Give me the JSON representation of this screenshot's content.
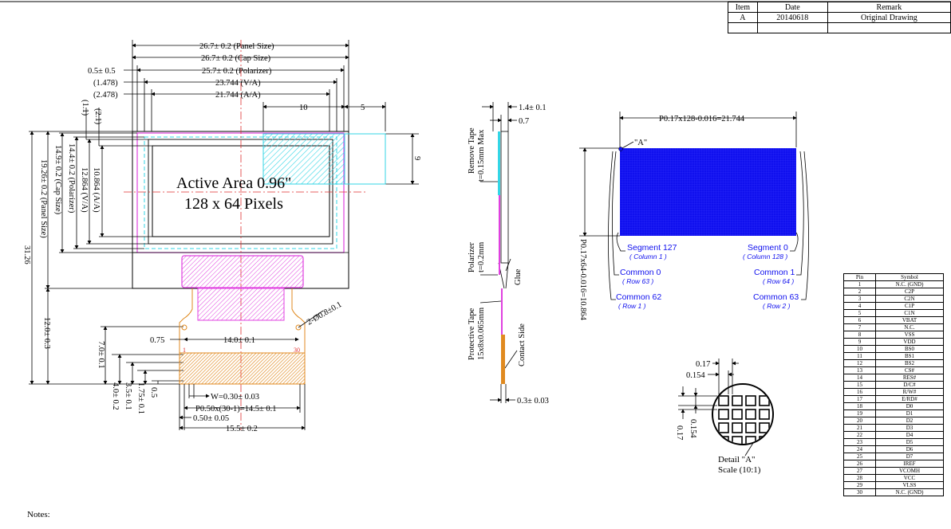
{
  "revision_table": {
    "headers": [
      "Item",
      "Date",
      "Remark"
    ],
    "rows": [
      [
        "A",
        "20140618",
        "Original Drawing"
      ],
      [
        "",
        "",
        ""
      ]
    ]
  },
  "front_view": {
    "dims_top": {
      "panel_size": "26.7± 0.2 (Panel Size)",
      "cap_size": "26.7± 0.2 (Cap Size)",
      "polarizer": "25.7± 0.2 (Polarizer)",
      "va": "23.744 (V/A)",
      "aa": "21.744 (A/A)",
      "offset_1": "0.5± 0.5",
      "offset_2": "(1.478)",
      "offset_3": "(2.478)",
      "dim_10": "10",
      "dim_5": "5",
      "dim_9": "9"
    },
    "dims_left": {
      "d1": "(1.1)",
      "d2": "(2.1)",
      "aa": "10.864 (A/A)",
      "va": "12.864 (V/A)",
      "polarizer": "14.4± 0.2 (Polarizer)",
      "cap": "14.9± 0.2 (Cap Size)",
      "panel": "19.26± 0.2 (Panel Size)",
      "total": "31.26",
      "fpc_len": "12.0± 0.3",
      "d7": "7.0± 0.1",
      "d4": "4.0± 0.2",
      "d35": "3.5± 0.1",
      "d175": "1.75± 0.1",
      "d05": "0.5"
    },
    "active_area_title": "Active Area 0.96\"",
    "pixels_label": "128 x 64 Pixels",
    "fpc": {
      "hole_dim": "2-Ø0.8±0.1",
      "left_offset": "0.75",
      "pitch_span": "14.0± 0.1",
      "pin_1": "1",
      "pin_30": "30",
      "width": "W=0.30± 0.03",
      "pitch": "P0.50x(30-1)=14.5± 0.1",
      "edge": "0.50± 0.05",
      "total_width": "15.5± 0.2"
    }
  },
  "side_view": {
    "thickness": "1.4± 0.1",
    "glass": "0.7",
    "remove_tape": "Remove Tape",
    "remove_tape_spec": "t=0.15mm Max",
    "polarizer": "Polarizer",
    "polarizer_spec": "t=0.2mm",
    "glue": "Glue",
    "protective_tape": "Protective Tape",
    "protective_spec": "15x8x0.065mm",
    "contact_side": "Contact Side",
    "fpc_thickness": "0.3± 0.03"
  },
  "pixel_view": {
    "width_dim": "P0.17x128-0.016=21.744",
    "height_dim": "P0.17x64-0.016=10.864",
    "detail_marker": "\"A\"",
    "seg127": "Segment 127",
    "col1": "( Column 1 )",
    "seg0": "Segment 0",
    "col128": "( Column 128 )",
    "com0": "Common 0",
    "row63": "( Row 63 )",
    "com1": "Common 1",
    "row64": "( Row 64 )",
    "com62": "Common 62",
    "row1": "( Row 1 )",
    "com63": "Common 63",
    "row2": "( Row 2 )"
  },
  "detail": {
    "d017": "0.17",
    "d0154": "0.154",
    "v017": "0.17",
    "v0154": "0.154",
    "title": "Detail \"A\"",
    "scale": "Scale (10:1)"
  },
  "pin_table": {
    "headers": [
      "Pin",
      "Symbol"
    ],
    "rows": [
      [
        "1",
        "N.C. (GND)"
      ],
      [
        "2",
        "C2P"
      ],
      [
        "3",
        "C2N"
      ],
      [
        "4",
        "C1P"
      ],
      [
        "5",
        "C1N"
      ],
      [
        "6",
        "VBAT"
      ],
      [
        "7",
        "N.C."
      ],
      [
        "8",
        "VSS"
      ],
      [
        "9",
        "VDD"
      ],
      [
        "10",
        "BS0"
      ],
      [
        "11",
        "BS1"
      ],
      [
        "12",
        "BS2"
      ],
      [
        "13",
        "CS#"
      ],
      [
        "14",
        "RES#"
      ],
      [
        "15",
        "D/C#"
      ],
      [
        "16",
        "R/W#"
      ],
      [
        "17",
        "E/RD#"
      ],
      [
        "18",
        "D0"
      ],
      [
        "19",
        "D1"
      ],
      [
        "20",
        "D2"
      ],
      [
        "21",
        "D3"
      ],
      [
        "22",
        "D4"
      ],
      [
        "23",
        "D5"
      ],
      [
        "24",
        "D6"
      ],
      [
        "25",
        "D7"
      ],
      [
        "26",
        "IREF"
      ],
      [
        "27",
        "VCOMH"
      ],
      [
        "28",
        "VCC"
      ],
      [
        "29",
        "VLSS"
      ],
      [
        "30",
        "N.C. (GND)"
      ]
    ]
  },
  "notes_label": "Notes:",
  "colors": {
    "panel_pink": "#e040e0",
    "cyan": "#33d6e6",
    "pixel_blue": "#1010ee",
    "fpc_orange": "#e08a20",
    "centerline_red": "#e03030"
  }
}
